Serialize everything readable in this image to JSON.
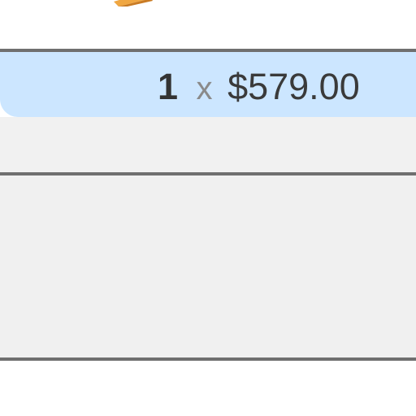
{
  "cart_line": {
    "quantity": "1",
    "multiplier": "x",
    "unit_price": "$579.00"
  },
  "colors": {
    "price_row_background": "#cce6ff",
    "divider": "#6f6f6f",
    "panel_background": "#f0f0f0"
  },
  "icons": {
    "product_image": "product-thumbnail-icon"
  }
}
